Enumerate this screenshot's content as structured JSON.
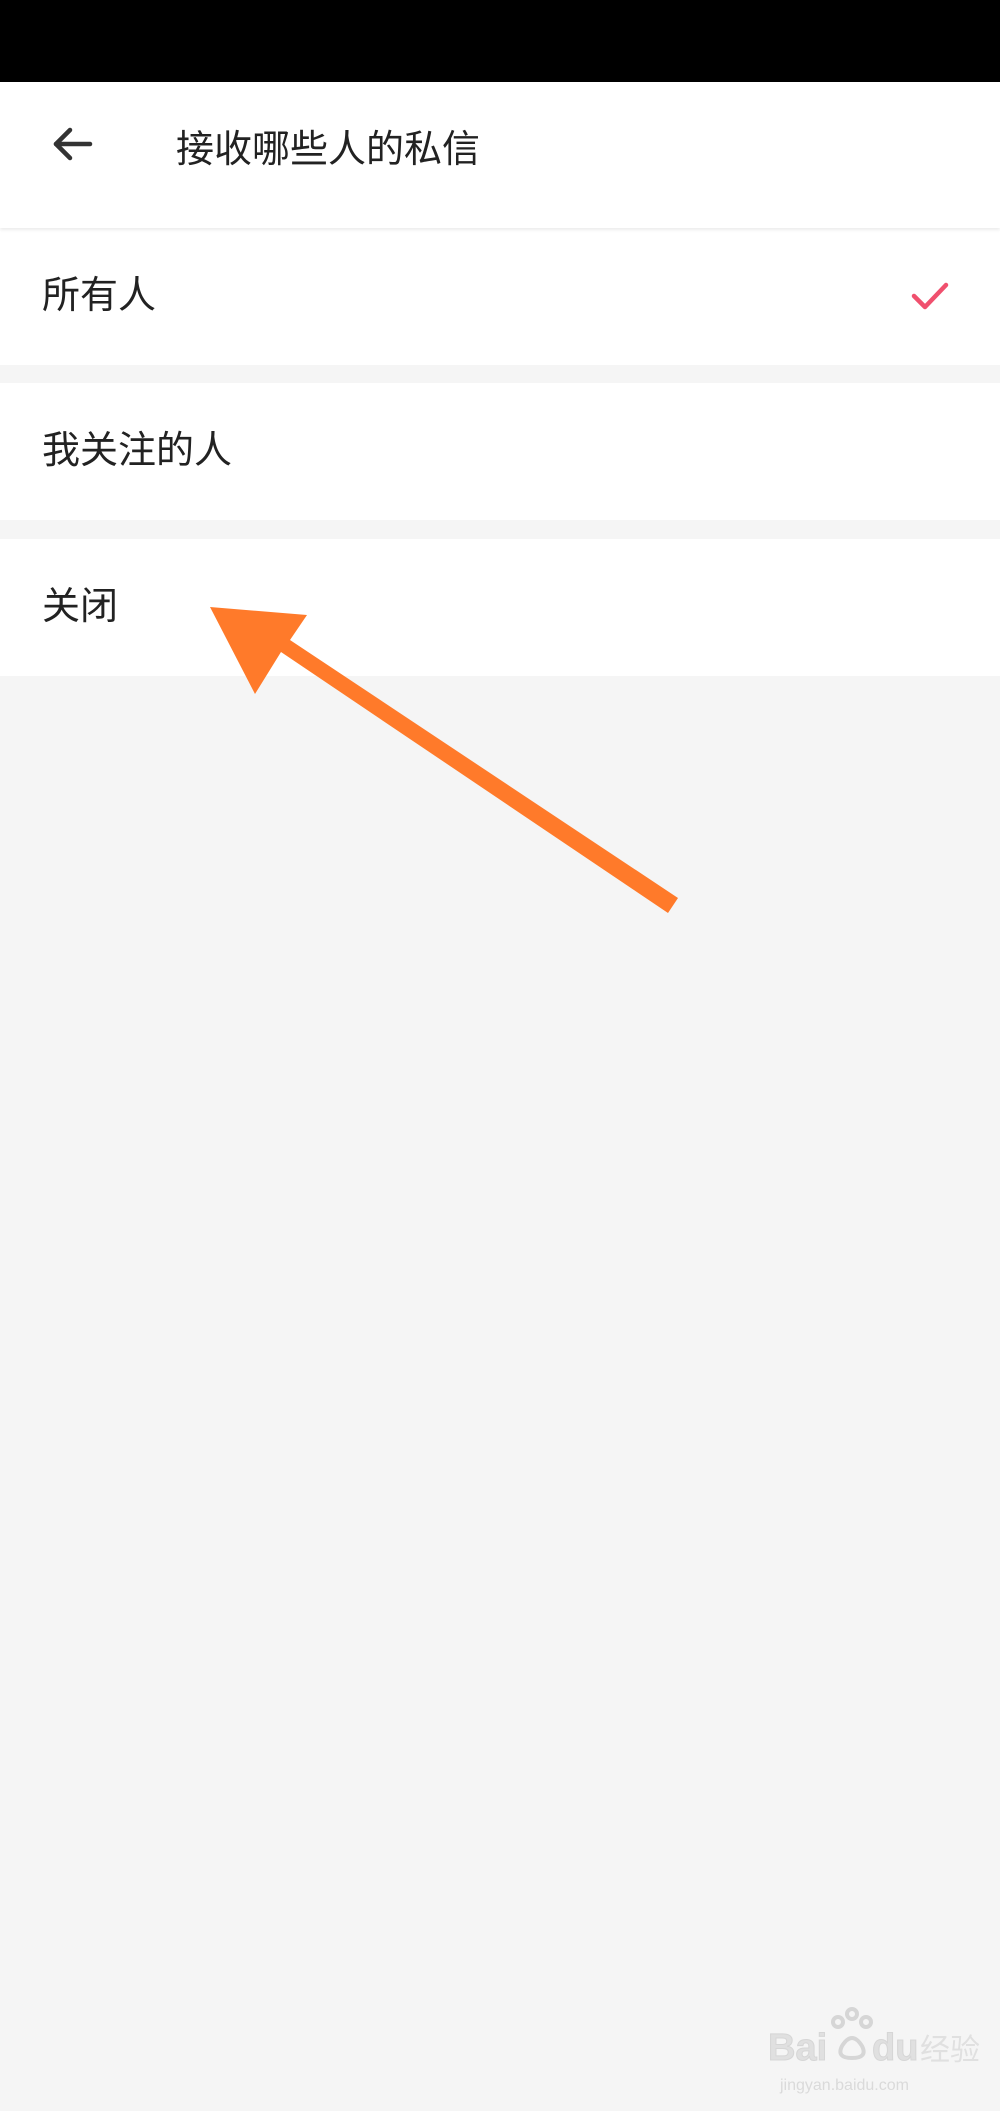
{
  "header": {
    "title": "接收哪些人的私信",
    "back_icon": "arrow-left-icon"
  },
  "options": [
    {
      "label": "所有人",
      "selected": true
    },
    {
      "label": "我关注的人",
      "selected": false
    },
    {
      "label": "关闭",
      "selected": false
    }
  ],
  "selected_icon": "checkmark-icon",
  "colors": {
    "status_bar": "#000000",
    "background": "#f5f5f5",
    "row_background": "#ffffff",
    "check": "#f0506e",
    "annotation_arrow": "#ff7a2a"
  },
  "watermark": {
    "brand": "Baidu经验",
    "url": "jingyan.baidu.com"
  }
}
